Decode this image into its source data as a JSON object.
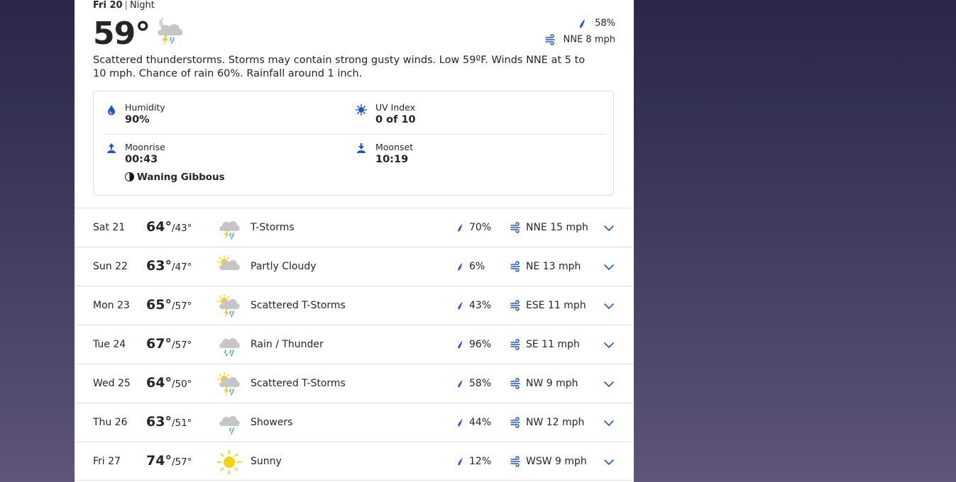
{
  "header": {
    "day": "Fri 20",
    "separator": "|",
    "period": "Night",
    "temperature": "59°",
    "condition_icon": "thunderstorm-night-icon",
    "precip": "58%",
    "wind": "NNE 8 mph",
    "narrative": "Scattered thunderstorms. Storms may contain strong gusty winds. Low 59ºF. Winds NNE at 5 to 10 mph. Chance of rain 60%. Rainfall around 1 inch."
  },
  "details": {
    "humidity_label": "Humidity",
    "humidity_value": "90%",
    "uv_label": "UV Index",
    "uv_value": "0 of 10",
    "moonrise_label": "Moonrise",
    "moonrise_value": "00:43",
    "moonset_label": "Moonset",
    "moonset_value": "10:19",
    "moon_phase": "Waning Gibbous"
  },
  "forecast": [
    {
      "day": "Sat 21",
      "hi": "64°",
      "lo": "/43°",
      "icon": "thunderstorm-icon",
      "condition": "T-Storms",
      "precip": "70%",
      "wind": "NNE 15 mph"
    },
    {
      "day": "Sun 22",
      "hi": "63°",
      "lo": "/47°",
      "icon": "partly-cloudy-icon",
      "condition": "Partly Cloudy",
      "precip": "6%",
      "wind": "NE 13 mph"
    },
    {
      "day": "Mon 23",
      "hi": "65°",
      "lo": "/57°",
      "icon": "scattered-thunderstorm-icon",
      "condition": "Scattered T-Storms",
      "precip": "43%",
      "wind": "ESE 11 mph"
    },
    {
      "day": "Tue 24",
      "hi": "67°",
      "lo": "/57°",
      "icon": "rain-thunder-icon",
      "condition": "Rain / Thunder",
      "precip": "96%",
      "wind": "SE 11 mph"
    },
    {
      "day": "Wed 25",
      "hi": "64°",
      "lo": "/50°",
      "icon": "scattered-thunderstorm-icon",
      "condition": "Scattered T-Storms",
      "precip": "58%",
      "wind": "NW 9 mph"
    },
    {
      "day": "Thu 26",
      "hi": "63°",
      "lo": "/51°",
      "icon": "showers-icon",
      "condition": "Showers",
      "precip": "44%",
      "wind": "NW 12 mph"
    },
    {
      "day": "Fri 27",
      "hi": "74°",
      "lo": "/57°",
      "icon": "sunny-icon",
      "condition": "Sunny",
      "precip": "12%",
      "wind": "WSW 9 mph"
    }
  ],
  "colors": {
    "accent": "#2053d6",
    "text": "#252525",
    "divider": "#dedede",
    "sun": "#f5d10f",
    "cloud": "#c6c6c6",
    "bolt": "#f5c518",
    "rain_drop": "#48a3d8"
  }
}
